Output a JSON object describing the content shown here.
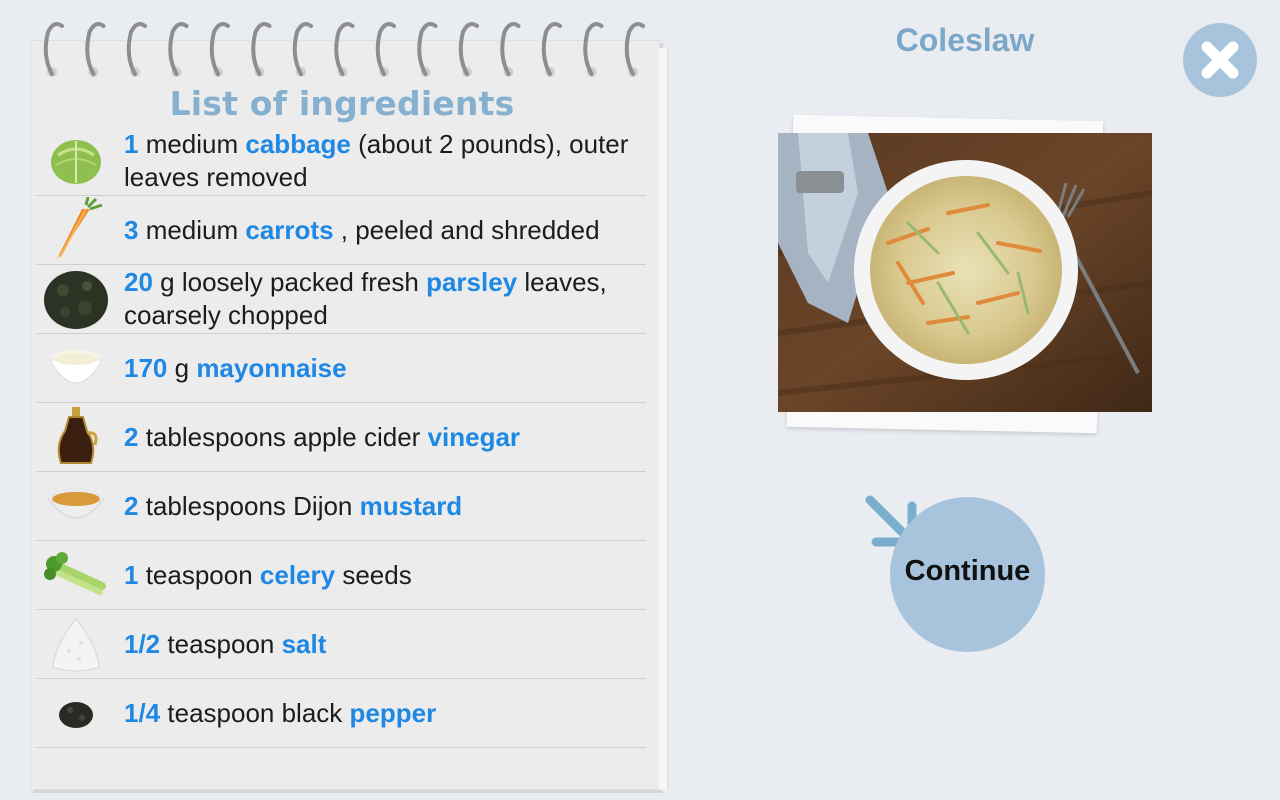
{
  "notebook": {
    "title": "List of ingredients",
    "ingredients": [
      {
        "icon": "cabbage-icon",
        "qty": "1",
        "pre": " medium ",
        "name": "cabbage",
        "post": " (about 2 pounds), outer leaves removed"
      },
      {
        "icon": "carrot-icon",
        "qty": "3",
        "pre": " medium ",
        "name": "carrots",
        "post": " , peeled and shredded"
      },
      {
        "icon": "parsley-icon",
        "qty": "20",
        "pre": " g loosely packed fresh ",
        "name": "parsley",
        "post": " leaves, coarsely chopped"
      },
      {
        "icon": "mayonnaise-icon",
        "qty": "170",
        "pre": " g ",
        "name": "mayonnaise",
        "post": ""
      },
      {
        "icon": "vinegar-icon",
        "qty": "2",
        "pre": " tablespoons apple cider ",
        "name": "vinegar",
        "post": ""
      },
      {
        "icon": "mustard-icon",
        "qty": "2",
        "pre": " tablespoons Dijon ",
        "name": "mustard",
        "post": ""
      },
      {
        "icon": "celery-icon",
        "qty": "1",
        "pre": " teaspoon ",
        "name": "celery",
        "post": " seeds"
      },
      {
        "icon": "salt-icon",
        "qty": "1/2",
        "pre": " teaspoon ",
        "name": "salt",
        "post": ""
      },
      {
        "icon": "pepper-icon",
        "qty": "1/4",
        "pre": " teaspoon black ",
        "name": "pepper",
        "post": ""
      }
    ]
  },
  "recipe": {
    "title": "Coleslaw",
    "photo_icon": "coleslaw-photo"
  },
  "buttons": {
    "continue_label": "Continue",
    "close_icon": "close-icon"
  },
  "colors": {
    "accent": "#1e88e5",
    "title": "#86b0cf",
    "button": "#a7c4dc",
    "background": "#e9edf2"
  }
}
